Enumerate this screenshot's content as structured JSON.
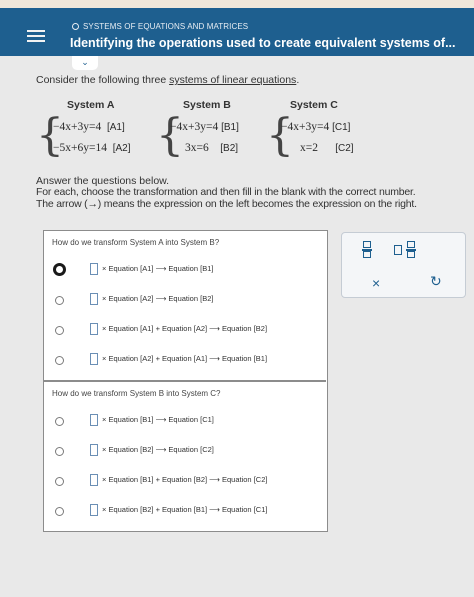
{
  "header": {
    "breadcrumb": "SYSTEMS OF EQUATIONS AND MATRICES",
    "title": "Identifying the operations used to create equivalent systems of..."
  },
  "intro": {
    "prefix": "Consider the following three ",
    "link": "systems of linear equations",
    "suffix": "."
  },
  "systems": [
    {
      "name": "System A",
      "eq1": "−4x+3y=4",
      "tag1": "[A1]",
      "eq2": "−5x+6y=14",
      "tag2": "[A2]"
    },
    {
      "name": "System B",
      "eq1": "−4x+3y=4",
      "tag1": "[B1]",
      "eq2": "3x=6",
      "tag2": "[B2]"
    },
    {
      "name": "System C",
      "eq1": "−4x+3y=4",
      "tag1": "[C1]",
      "eq2": "x=2",
      "tag2": "[C2]"
    }
  ],
  "instructions": {
    "line1": "Answer the questions below.",
    "line2": "For each, choose the transformation and then fill in the blank with the correct number.",
    "line3_prefix": "The arrow (",
    "line3_arrow": "→",
    "line3_suffix": ") means the expression on the left becomes the expression on the right."
  },
  "question1": {
    "title": "How do we transform System A into System B?",
    "options": [
      "× Equation [A1] ⟶ Equation [B1]",
      "× Equation [A2] ⟶ Equation [B2]",
      "× Equation [A1] + Equation [A2] ⟶ Equation [B2]",
      "× Equation [A2] + Equation [A1] ⟶ Equation [B1]"
    ],
    "selected": 0
  },
  "question2": {
    "title": "How do we transform System B into System C?",
    "options": [
      "× Equation [B1] ⟶ Equation [C1]",
      "× Equation [B2] ⟶ Equation [C2]",
      "× Equation [B1] + Equation [B2] ⟶ Equation [C2]",
      "× Equation [B2] + Equation [B1] ⟶ Equation [C1]"
    ]
  },
  "toolbar": {
    "clear_symbol": "×",
    "undo_symbol": "↻"
  },
  "colors": {
    "header_bg": "#1e5f8f",
    "accent": "#1e5f8f",
    "panel_border": "#8c8c8c"
  },
  "icons": {
    "menu": "hamburger-icon",
    "collapse": "chevron-down-icon",
    "fraction": "fraction-icon",
    "mixed_number": "mixed-number-icon",
    "clear": "close-icon",
    "undo": "undo-icon"
  }
}
